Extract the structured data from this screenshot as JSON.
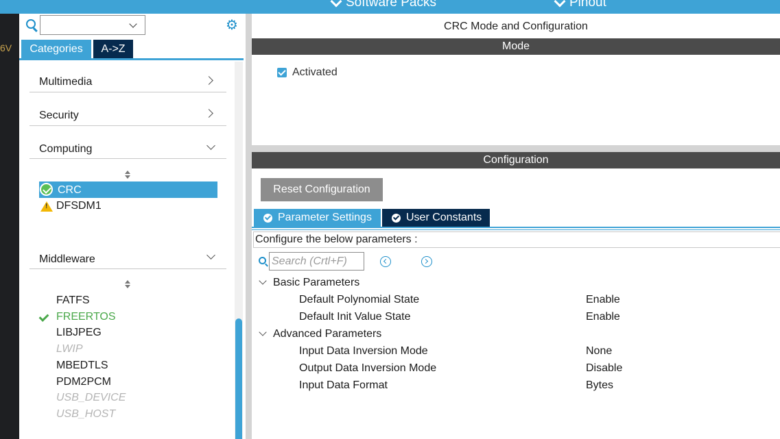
{
  "top_bar": {
    "software_packs_label": "Software Packs",
    "pinout_label": "Pinout"
  },
  "side_strip": {
    "text": "6V"
  },
  "left_panel": {
    "search": {
      "value": ""
    },
    "tabs": [
      {
        "label": "Categories",
        "active": true
      },
      {
        "label": "A->Z",
        "active": false
      }
    ],
    "categories": [
      {
        "label": "Multimedia",
        "expanded": false
      },
      {
        "label": "Security",
        "expanded": false
      },
      {
        "label": "Computing",
        "expanded": true,
        "items": [
          {
            "label": "CRC",
            "status": "configured",
            "selected": true
          },
          {
            "label": "DFSDM1",
            "status": "warning",
            "selected": false
          }
        ]
      },
      {
        "label": "Middleware",
        "expanded": true,
        "items": [
          {
            "label": "FATFS",
            "status": "normal"
          },
          {
            "label": "FREERTOS",
            "status": "enabled"
          },
          {
            "label": "LIBJPEG",
            "status": "normal"
          },
          {
            "label": "LWIP",
            "status": "disabled"
          },
          {
            "label": "MBEDTLS",
            "status": "normal"
          },
          {
            "label": "PDM2PCM",
            "status": "normal"
          },
          {
            "label": "USB_DEVICE",
            "status": "disabled"
          },
          {
            "label": "USB_HOST",
            "status": "disabled"
          }
        ]
      }
    ]
  },
  "right_panel": {
    "title": "CRC Mode and Configuration",
    "mode": {
      "header": "Mode",
      "activated_label": "Activated",
      "activated_checked": true
    },
    "configuration": {
      "header": "Configuration",
      "reset_button": "Reset Configuration",
      "tabs": [
        {
          "label": "Parameter Settings",
          "active": true
        },
        {
          "label": "User Constants",
          "active": false
        }
      ],
      "instruction": "Configure the below parameters :",
      "search_placeholder": "Search (Crtl+F)",
      "groups": [
        {
          "label": "Basic Parameters",
          "params": [
            {
              "name": "Default Polynomial State",
              "value": "Enable"
            },
            {
              "name": "Default Init Value State",
              "value": "Enable"
            }
          ]
        },
        {
          "label": "Advanced Parameters",
          "params": [
            {
              "name": "Input Data Inversion Mode",
              "value": "None"
            },
            {
              "name": "Output Data Inversion Mode",
              "value": "Disable"
            },
            {
              "name": "Input Data Format",
              "value": "Bytes"
            }
          ]
        }
      ]
    }
  },
  "colors": {
    "accent": "#3ea3d6",
    "dark_tab": "#062a4e",
    "header_bar": "#4b4b4b",
    "enabled_green": "#4aa84a",
    "warning_yellow": "#f2b705"
  }
}
